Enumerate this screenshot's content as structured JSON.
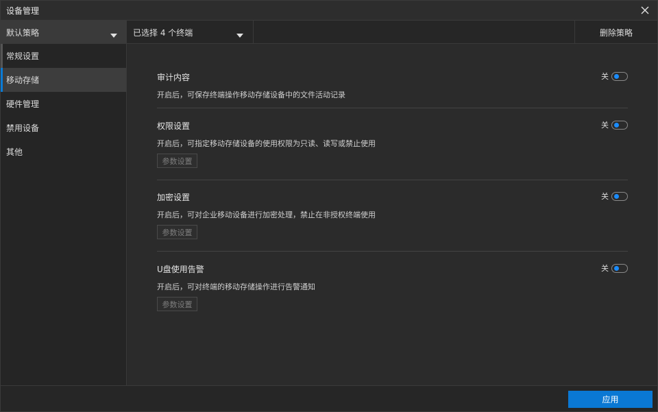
{
  "window": {
    "title": "设备管理"
  },
  "toolbar": {
    "policy": "默认策略",
    "terminals": "已选择 4 个终端",
    "delete_label": "删除策略"
  },
  "sidebar": {
    "items": [
      {
        "label": "常规设置"
      },
      {
        "label": "移动存储"
      },
      {
        "label": "硬件管理"
      },
      {
        "label": "禁用设备"
      },
      {
        "label": "其他"
      }
    ]
  },
  "sections": [
    {
      "title": "审计内容",
      "description": "开启后，可保存终端操作移动存储设备中的文件活动记录",
      "toggle_label": "关"
    },
    {
      "title": "权限设置",
      "description": "开启后，可指定移动存储设备的使用权限为只读、读写或禁止使用",
      "toggle_label": "关",
      "param_label": "参数设置"
    },
    {
      "title": "加密设置",
      "description": "开启后，可对企业移动设备进行加密处理，禁止在非授权终端使用",
      "toggle_label": "关",
      "param_label": "参数设置"
    },
    {
      "title": "U盘使用告警",
      "description": "开启后，可对终端的移动存储操作进行告警通知",
      "toggle_label": "关",
      "param_label": "参数设置"
    }
  ],
  "footer": {
    "apply_label": "应用"
  },
  "colors": {
    "accent": "#0a78d4",
    "toggle_knob": "#1a8cff"
  }
}
